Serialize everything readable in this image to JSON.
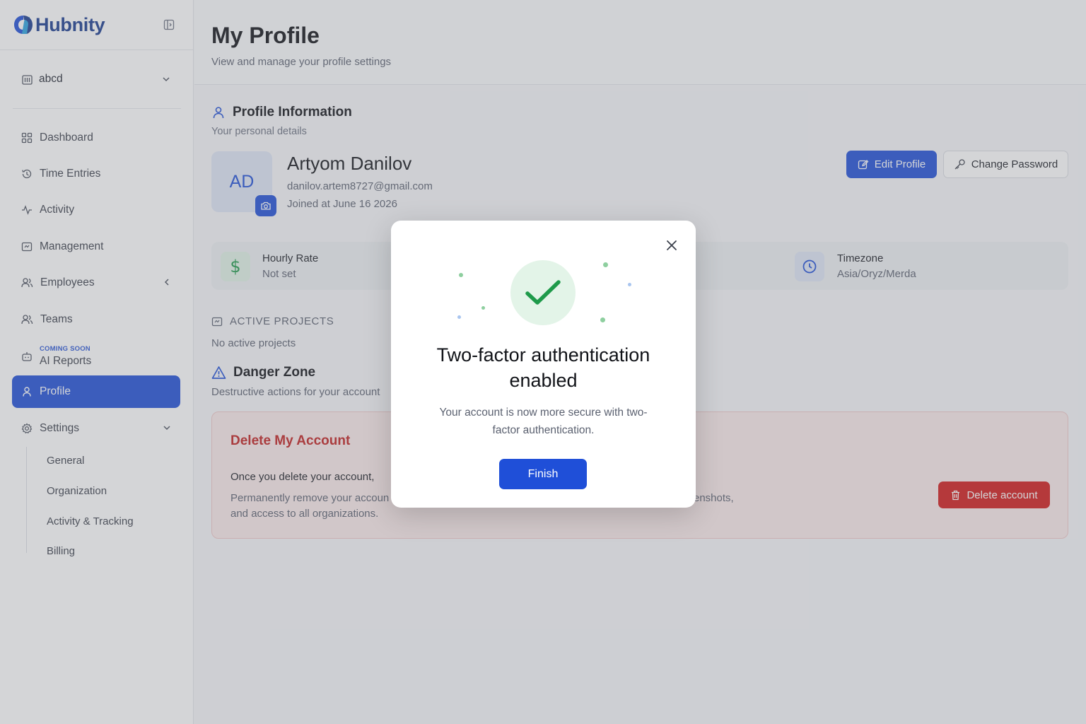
{
  "app": {
    "brand": "Hubnity",
    "brand_color": "#1a3c8f",
    "accent": "#1f4fd8"
  },
  "sidebar": {
    "org": {
      "label": "abcd",
      "icon": "building-icon"
    },
    "items": [
      {
        "label": "Dashboard",
        "icon": "grid-icon"
      },
      {
        "label": "Time Entries",
        "icon": "history-icon"
      },
      {
        "label": "Activity",
        "icon": "pulse-icon"
      },
      {
        "label": "Management",
        "icon": "folder-icon"
      },
      {
        "label": "Employees",
        "icon": "users-icon"
      },
      {
        "label": "Teams",
        "icon": "users-icon"
      },
      {
        "label": "AI Reports",
        "tag": "COMING SOON",
        "icon": "bot-icon"
      },
      {
        "label": "Profile",
        "icon": "user-icon",
        "active": true
      },
      {
        "label": "Settings",
        "icon": "gear-icon"
      }
    ],
    "settings_sub": [
      "General",
      "Organization",
      "Activity & Tracking",
      "Billing"
    ]
  },
  "page": {
    "title": "My Profile",
    "subtitle": "View and manage your profile settings"
  },
  "profile": {
    "section_title": "Profile Information",
    "section_sub": "Your personal details",
    "initials": "AD",
    "name": "Artyom Danilov",
    "email": "danilov.artem8727@gmail.com",
    "joined": "Joined at June 16 2026",
    "edit_label": "Edit Profile",
    "password_label": "Change Password"
  },
  "info": {
    "rate_label": "Hourly Rate",
    "rate_value": "Not set",
    "tz_label": "Timezone",
    "tz_value": "Asia/Oryz/Merda"
  },
  "projects": {
    "title": "ACTIVE PROJECTS",
    "empty": "No active projects"
  },
  "danger": {
    "title": "Danger Zone",
    "subtitle": "Destructive actions for your account",
    "box_title": "Delete My Account",
    "warning": "Once you delete your account,",
    "desc_line1_start": "Permanently remove your accoun",
    "desc_line1_end": "enshots,",
    "desc_line2": "and access to all organizations.",
    "button": "Delete account",
    "color": "#d11a1a"
  },
  "modal": {
    "title": "Two-factor authentication enabled",
    "text": "Your account is now more secure with two-factor authentication.",
    "button": "Finish",
    "success_color": "#1e9a4a"
  }
}
